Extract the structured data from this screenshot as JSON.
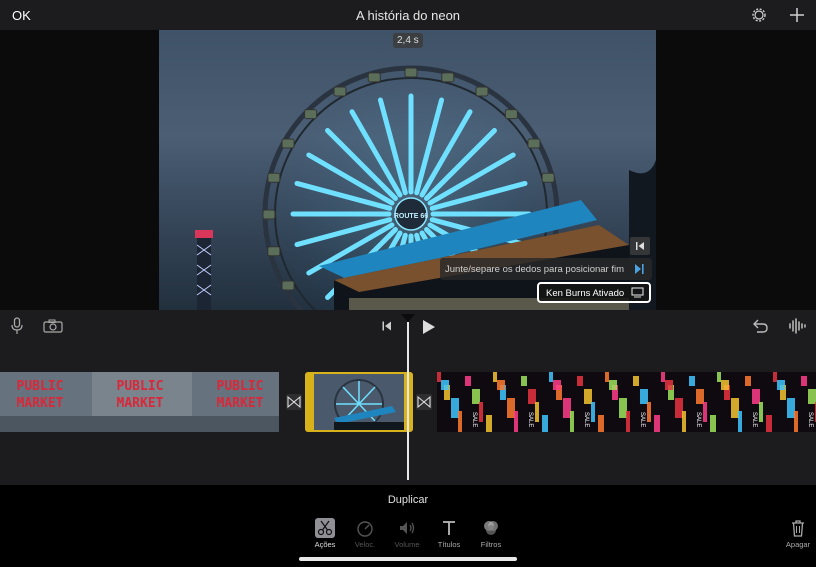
{
  "header": {
    "ok_label": "OK",
    "title": "A história do neon",
    "settings_icon": "gear-icon",
    "add_icon": "plus-icon"
  },
  "viewer": {
    "duration": "2,4 s",
    "hint": "Junte/separe os dedos para posicionar fim",
    "ken_burns_label": "Ken Burns Ativado",
    "photo_sign_text": "ROUTE 66"
  },
  "controls": {
    "mic_icon": "microphone-icon",
    "camera_icon": "camera-icon",
    "skip_back_icon": "skip-to-start-icon",
    "play_icon": "play-icon",
    "undo_icon": "undo-icon",
    "audio_icon": "waveform-icon"
  },
  "timeline": {
    "clip1_sign_text": [
      "PUBLIC",
      "MARKET"
    ],
    "clip3_sign_text": "SALE"
  },
  "bottom": {
    "duplicate_label": "Duplicar",
    "tools": [
      {
        "label": "Ações",
        "icon": "scissors-icon",
        "state": "active"
      },
      {
        "label": "Veloc.",
        "icon": "speedometer-icon",
        "state": "disabled"
      },
      {
        "label": "Volume",
        "icon": "speaker-icon",
        "state": "disabled"
      },
      {
        "label": "Títulos",
        "icon": "text-icon",
        "state": "normal"
      },
      {
        "label": "Filtros",
        "icon": "filters-icon",
        "state": "normal"
      }
    ],
    "delete_label": "Apagar",
    "delete_icon": "trash-icon"
  },
  "colors": {
    "selection": "#d8b21b",
    "neon_blue": "#5fd4ff",
    "background": "#1c1c1e"
  }
}
